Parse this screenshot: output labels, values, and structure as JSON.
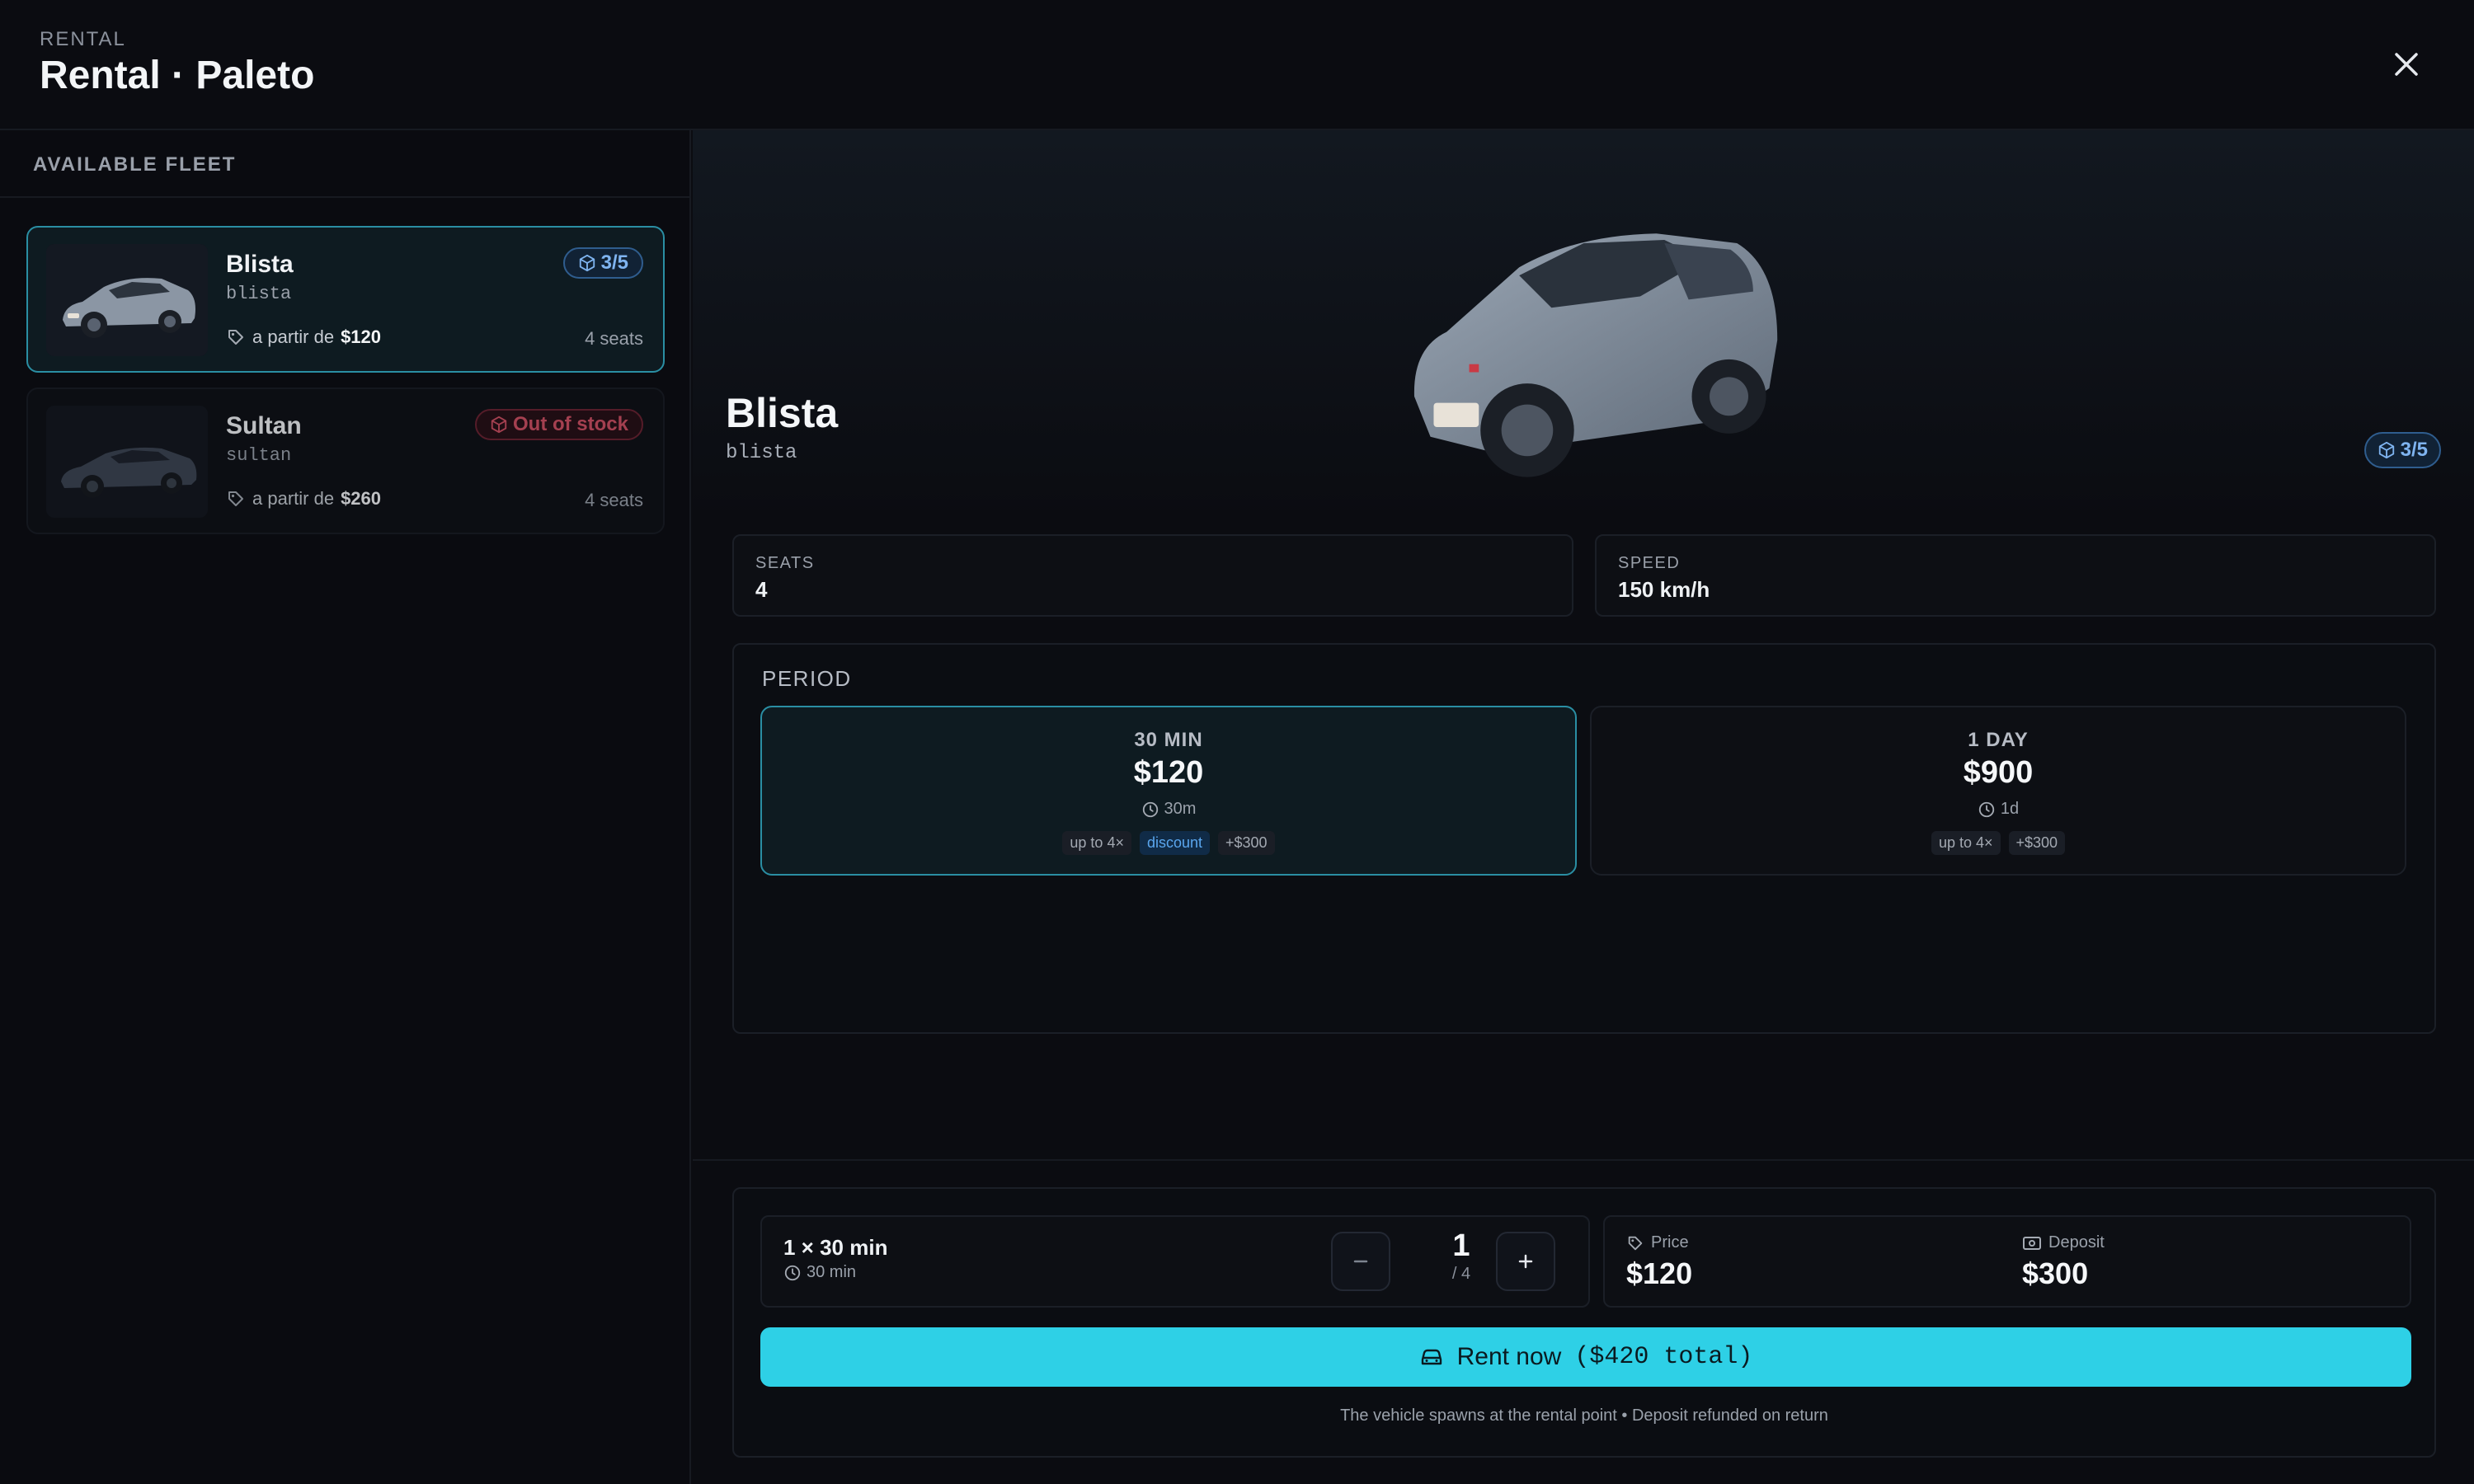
{
  "header": {
    "eyebrow": "RENTAL",
    "title": "Rental · Paleto",
    "close_icon": "close-icon"
  },
  "sidebar": {
    "heading": "AVAILABLE FLEET",
    "items": [
      {
        "name": "Blista",
        "code": "blista",
        "price_prefix": "a partir de",
        "price": "$120",
        "seats": "4 seats",
        "badge": "3/5",
        "badge_icon": "box-icon",
        "selected": true,
        "color": "#8b96a4"
      },
      {
        "name": "Sultan",
        "code": "sultan",
        "price_prefix": "a partir de",
        "price": "$260",
        "seats": "4 seats",
        "badge": "Out of stock",
        "badge_icon": "box-icon",
        "selected": false,
        "color": "#3b4452"
      }
    ]
  },
  "vehicle": {
    "name": "Blista",
    "code": "blista",
    "badge": "3/5",
    "stats": [
      {
        "label": "SEATS",
        "value": "4"
      },
      {
        "label": "SPEED",
        "value": "150 km/h"
      }
    ]
  },
  "period": {
    "label": "PERIOD",
    "options": [
      {
        "duration": "30 MIN",
        "price": "$120",
        "time": "30m",
        "chips": [
          "up to 4×",
          "discount",
          "+$300"
        ],
        "selected": true
      },
      {
        "duration": "1 DAY",
        "price": "$900",
        "time": "1d",
        "chips": [
          "up to 4×",
          "+$300"
        ],
        "selected": false
      }
    ]
  },
  "summary": {
    "title": "1 × 30 min",
    "subtitle": "30 min",
    "quantity": "1",
    "quantity_max": "/ 4",
    "price_label": "Price",
    "price_value": "$120",
    "deposit_label": "Deposit",
    "deposit_value": "$300",
    "rent_label": "Rent now",
    "rent_total": "($420 total)",
    "note": "The vehicle spawns at the rental point • Deposit refunded on return"
  },
  "colors": {
    "accent": "#2ed0e6",
    "selected_border": "#2a8ea3",
    "badge_blue": "#7fb4f0",
    "badge_red": "#d04f63"
  }
}
